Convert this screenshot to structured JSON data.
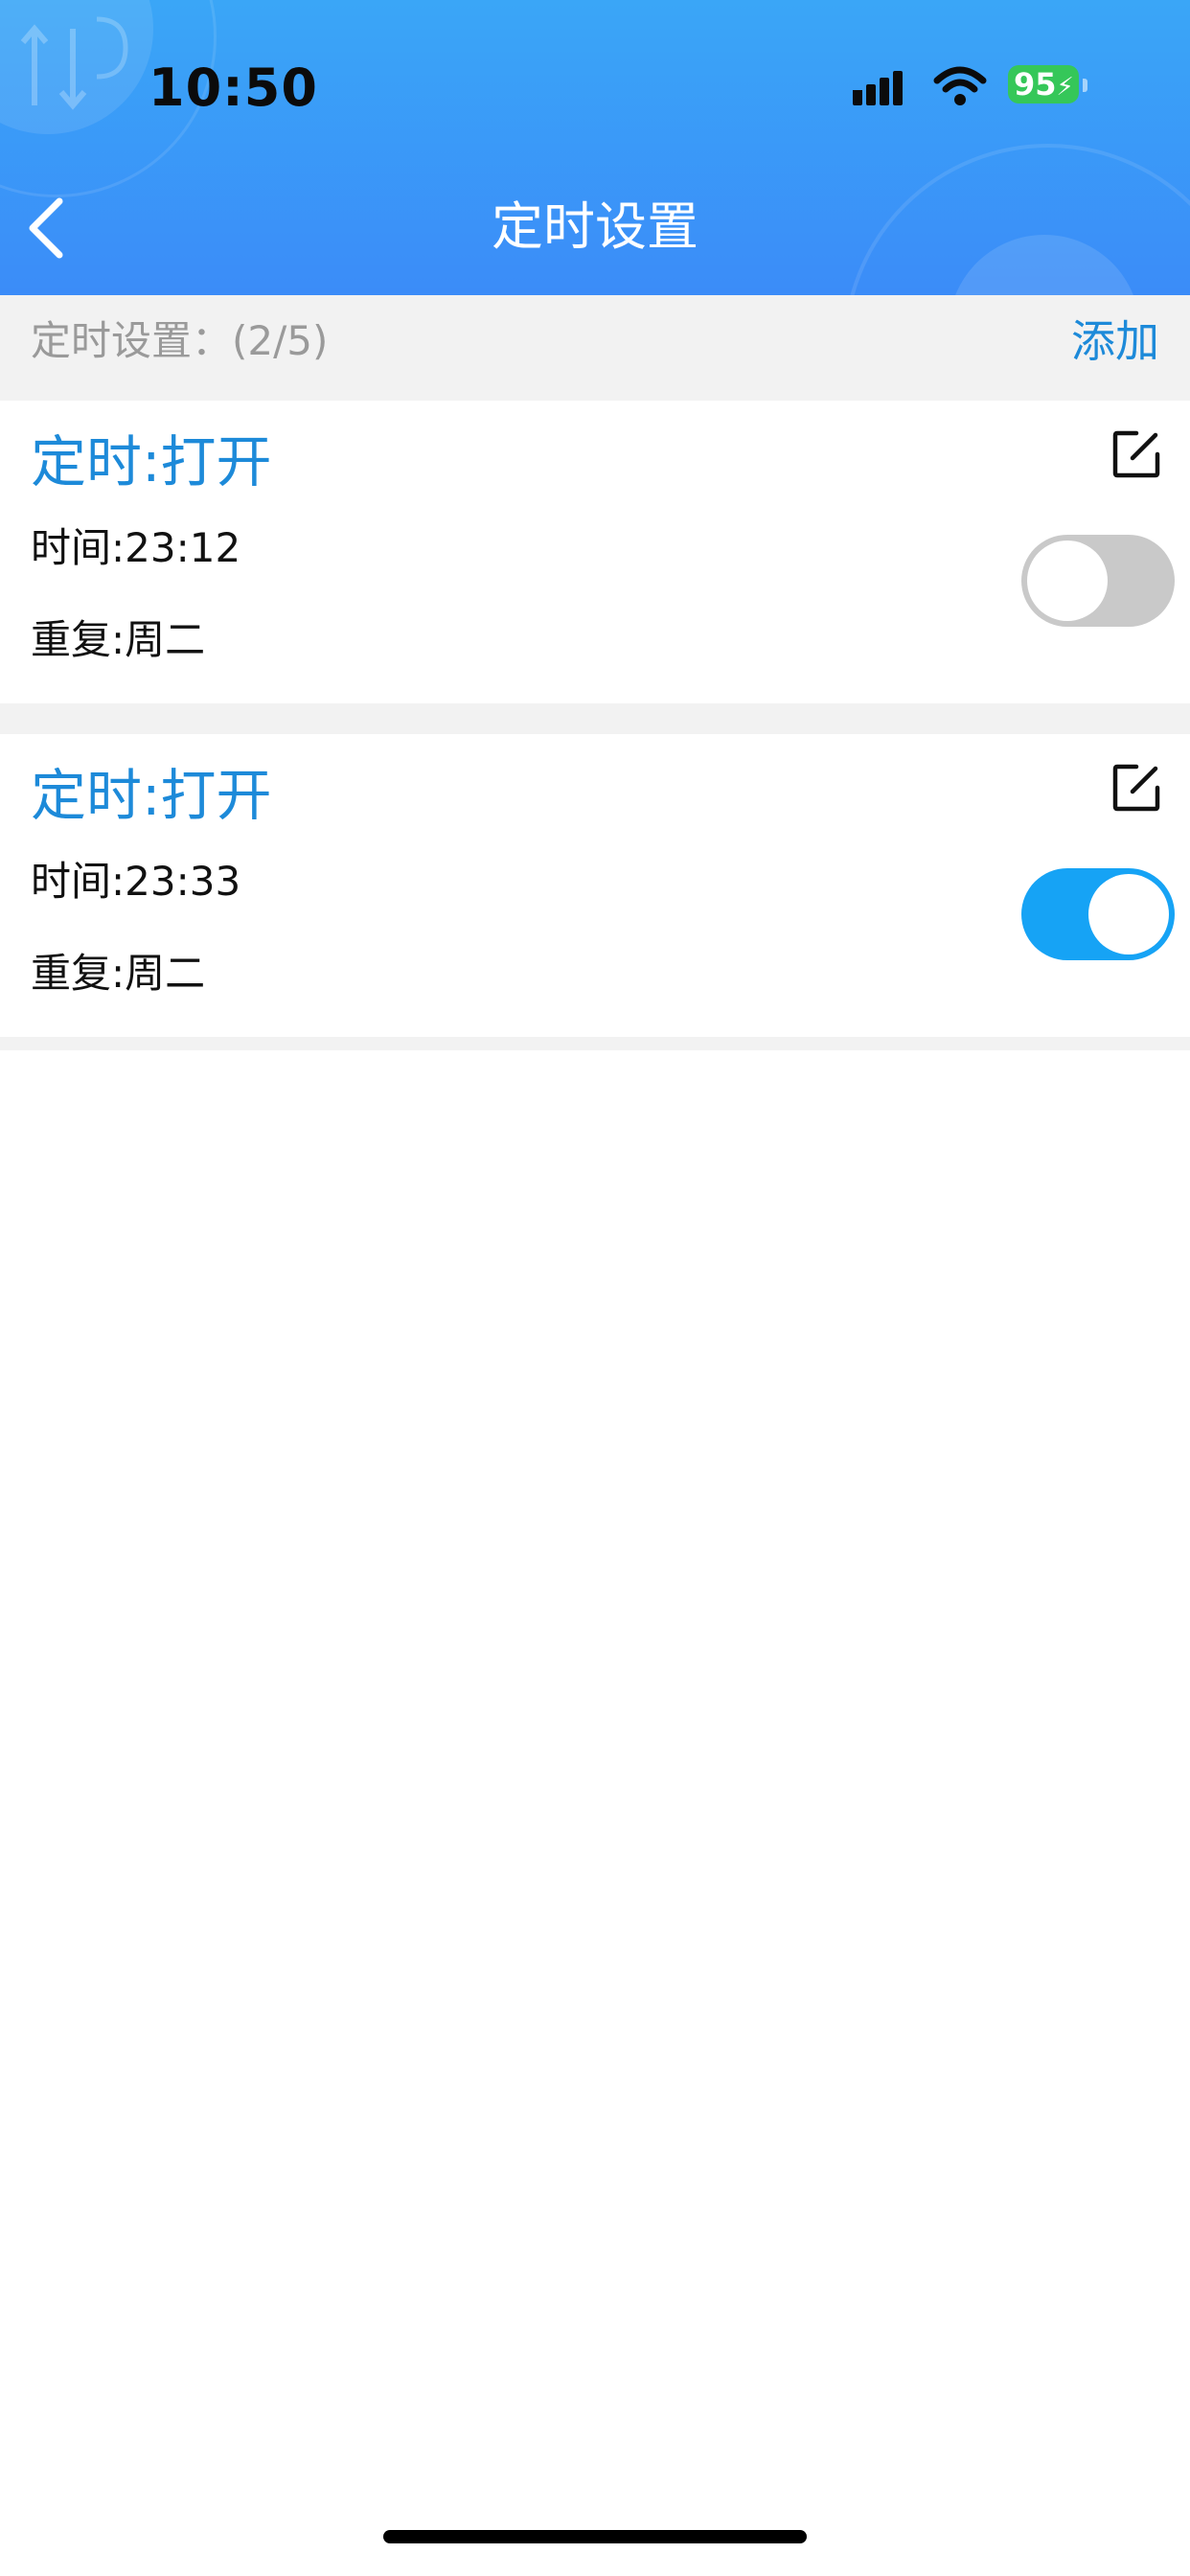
{
  "status_bar": {
    "time": "10:50",
    "battery": "95",
    "icons": [
      "signal-icon",
      "wifi-icon",
      "battery-charging-icon"
    ]
  },
  "header": {
    "title": "定时设置",
    "back_icon": "chevron-left-icon",
    "background_colors": [
      "#3aa6f7",
      "#3b8cf8"
    ]
  },
  "subheader": {
    "label": "定时设置：(2/5)",
    "add_label": "添加"
  },
  "timers": [
    {
      "title": "定时:打开",
      "time": "时间:23:12",
      "repeat": "重复:周二",
      "enabled": false
    },
    {
      "title": "定时:打开",
      "time": "时间:23:33",
      "repeat": "重复:周二",
      "enabled": true
    }
  ],
  "colors": {
    "accent": "#1d8ad9",
    "toggle_on": "#16a3f5",
    "toggle_off": "#c9c9c9",
    "battery_green": "#35c759"
  }
}
